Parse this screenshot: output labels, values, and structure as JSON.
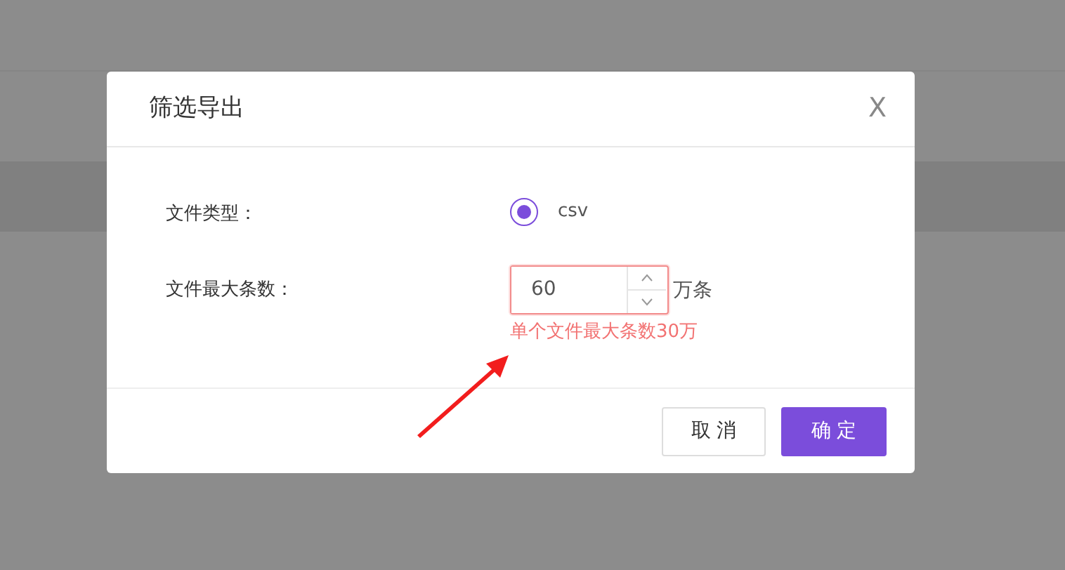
{
  "dialog": {
    "title": "筛选导出",
    "close": "X",
    "fields": [
      {
        "kind": "radio",
        "label": "文件类型：",
        "options": [
          {
            "label": "csv",
            "selected": true
          }
        ]
      },
      {
        "kind": "number",
        "label": "文件最大条数：",
        "value": "60",
        "unit": "万条",
        "error": "单个文件最大条数30万"
      }
    ],
    "buttons": [
      {
        "label": "取 消",
        "primary": false
      },
      {
        "label": "确 定",
        "primary": true
      }
    ]
  }
}
